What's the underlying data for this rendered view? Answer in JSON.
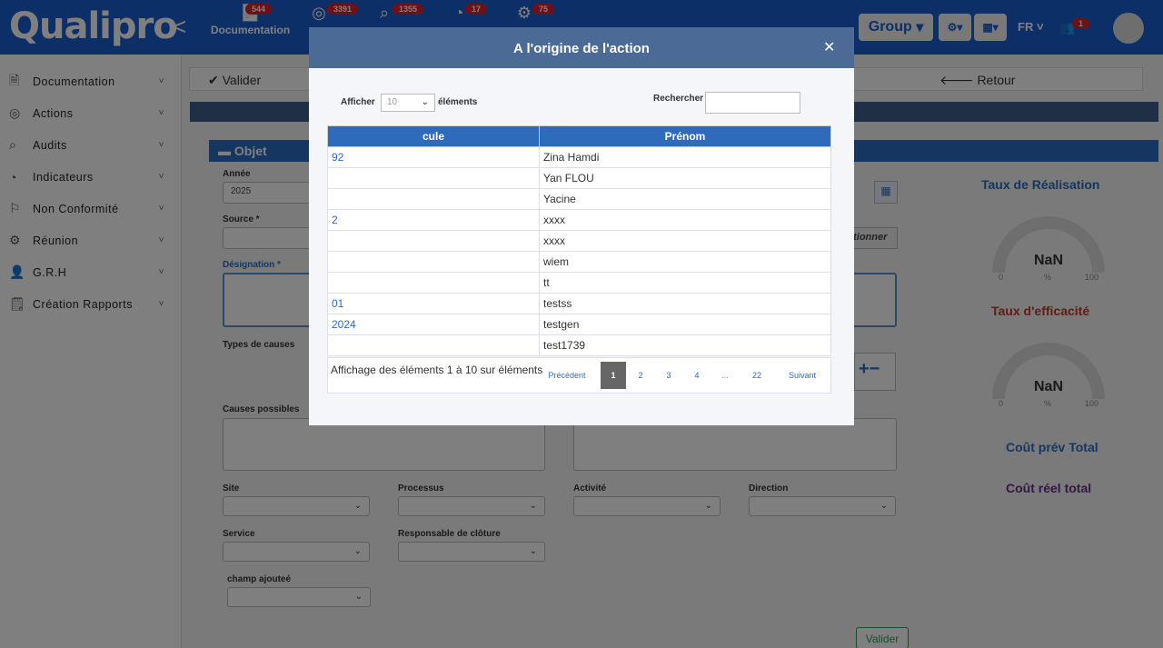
{
  "app": {
    "logo": "Qualipro",
    "collapse": "<"
  },
  "nav": [
    {
      "label": "Documentation",
      "badge": "544",
      "icon": "document-icon"
    },
    {
      "label": "",
      "badge": "3391",
      "icon": "actions-icon"
    },
    {
      "label": "",
      "badge": "1355",
      "icon": "audit-icon"
    },
    {
      "label": "",
      "badge": "17",
      "icon": "indicator-icon"
    },
    {
      "label": "",
      "badge": "75",
      "icon": "meeting-icon"
    }
  ],
  "topright": {
    "group": "Group",
    "lang": "FR",
    "user_badge": "1"
  },
  "sidebar": {
    "items": [
      {
        "label": "Documentation",
        "icon": "document-icon"
      },
      {
        "label": "Actions",
        "icon": "actions-icon"
      },
      {
        "label": "Audits",
        "icon": "audit-icon"
      },
      {
        "label": "Indicateurs",
        "icon": "indicator-icon"
      },
      {
        "label": "Non Conformité",
        "icon": "nonconformity-icon"
      },
      {
        "label": "Réunion",
        "icon": "meeting-icon"
      },
      {
        "label": "G.R.H",
        "icon": "user-icon"
      },
      {
        "label": "Création Rapports",
        "icon": "report-icon"
      }
    ]
  },
  "toolbar": {
    "validate": "Valider",
    "back": "Retour"
  },
  "form": {
    "section": "Objet",
    "year_label": "Année",
    "year_value": "2025",
    "source_label": "Source *",
    "designation_label": "Désignation *",
    "cause_types_label": "Types de causes",
    "possible_causes_label": "Causes possibles",
    "site_label": "Site",
    "process_label": "Processus",
    "activity_label": "Activité",
    "direction_label": "Direction",
    "service_label": "Service",
    "closure_label": "Responsable de clôture",
    "added_field_label": "champ ajouteé",
    "select_button": "ctionner",
    "submit": "Valider"
  },
  "stats": {
    "realisation_title": "Taux de Réalisation",
    "realisation_value": "NaN",
    "efficacite_title": "Taux d'efficacité",
    "efficacite_value": "NaN",
    "gauge_min": "0",
    "gauge_max": "100",
    "gauge_unit": "%",
    "cout_prev": "Coût prév Total",
    "cout_reel": "Coût réel total"
  },
  "modal": {
    "title": "A l'origine de l'action",
    "show_label": "Afficher",
    "show_value": "10",
    "elements_label": "éléments",
    "search_label": "Rechercher",
    "columns": [
      "cule",
      "Prénom"
    ],
    "rows": [
      {
        "mat": "92",
        "prenom": "Zina Hamdi"
      },
      {
        "mat": "",
        "prenom": "Yan FLOU"
      },
      {
        "mat": "",
        "prenom": "Yacine"
      },
      {
        "mat": "2",
        "prenom": "xxxx"
      },
      {
        "mat": "",
        "prenom": "xxxx"
      },
      {
        "mat": "",
        "prenom": "wiem"
      },
      {
        "mat": "",
        "prenom": "tt"
      },
      {
        "mat": "01",
        "prenom": "testss"
      },
      {
        "mat": "2024",
        "prenom": "testgen"
      },
      {
        "mat": "",
        "prenom": "test1739"
      }
    ],
    "info": "Affichage des éléments 1 à 10 sur éléments",
    "pager": {
      "prev": "Précédent",
      "pages": [
        "1",
        "2",
        "3",
        "4",
        "...",
        "22"
      ],
      "next": "Suivant"
    }
  }
}
